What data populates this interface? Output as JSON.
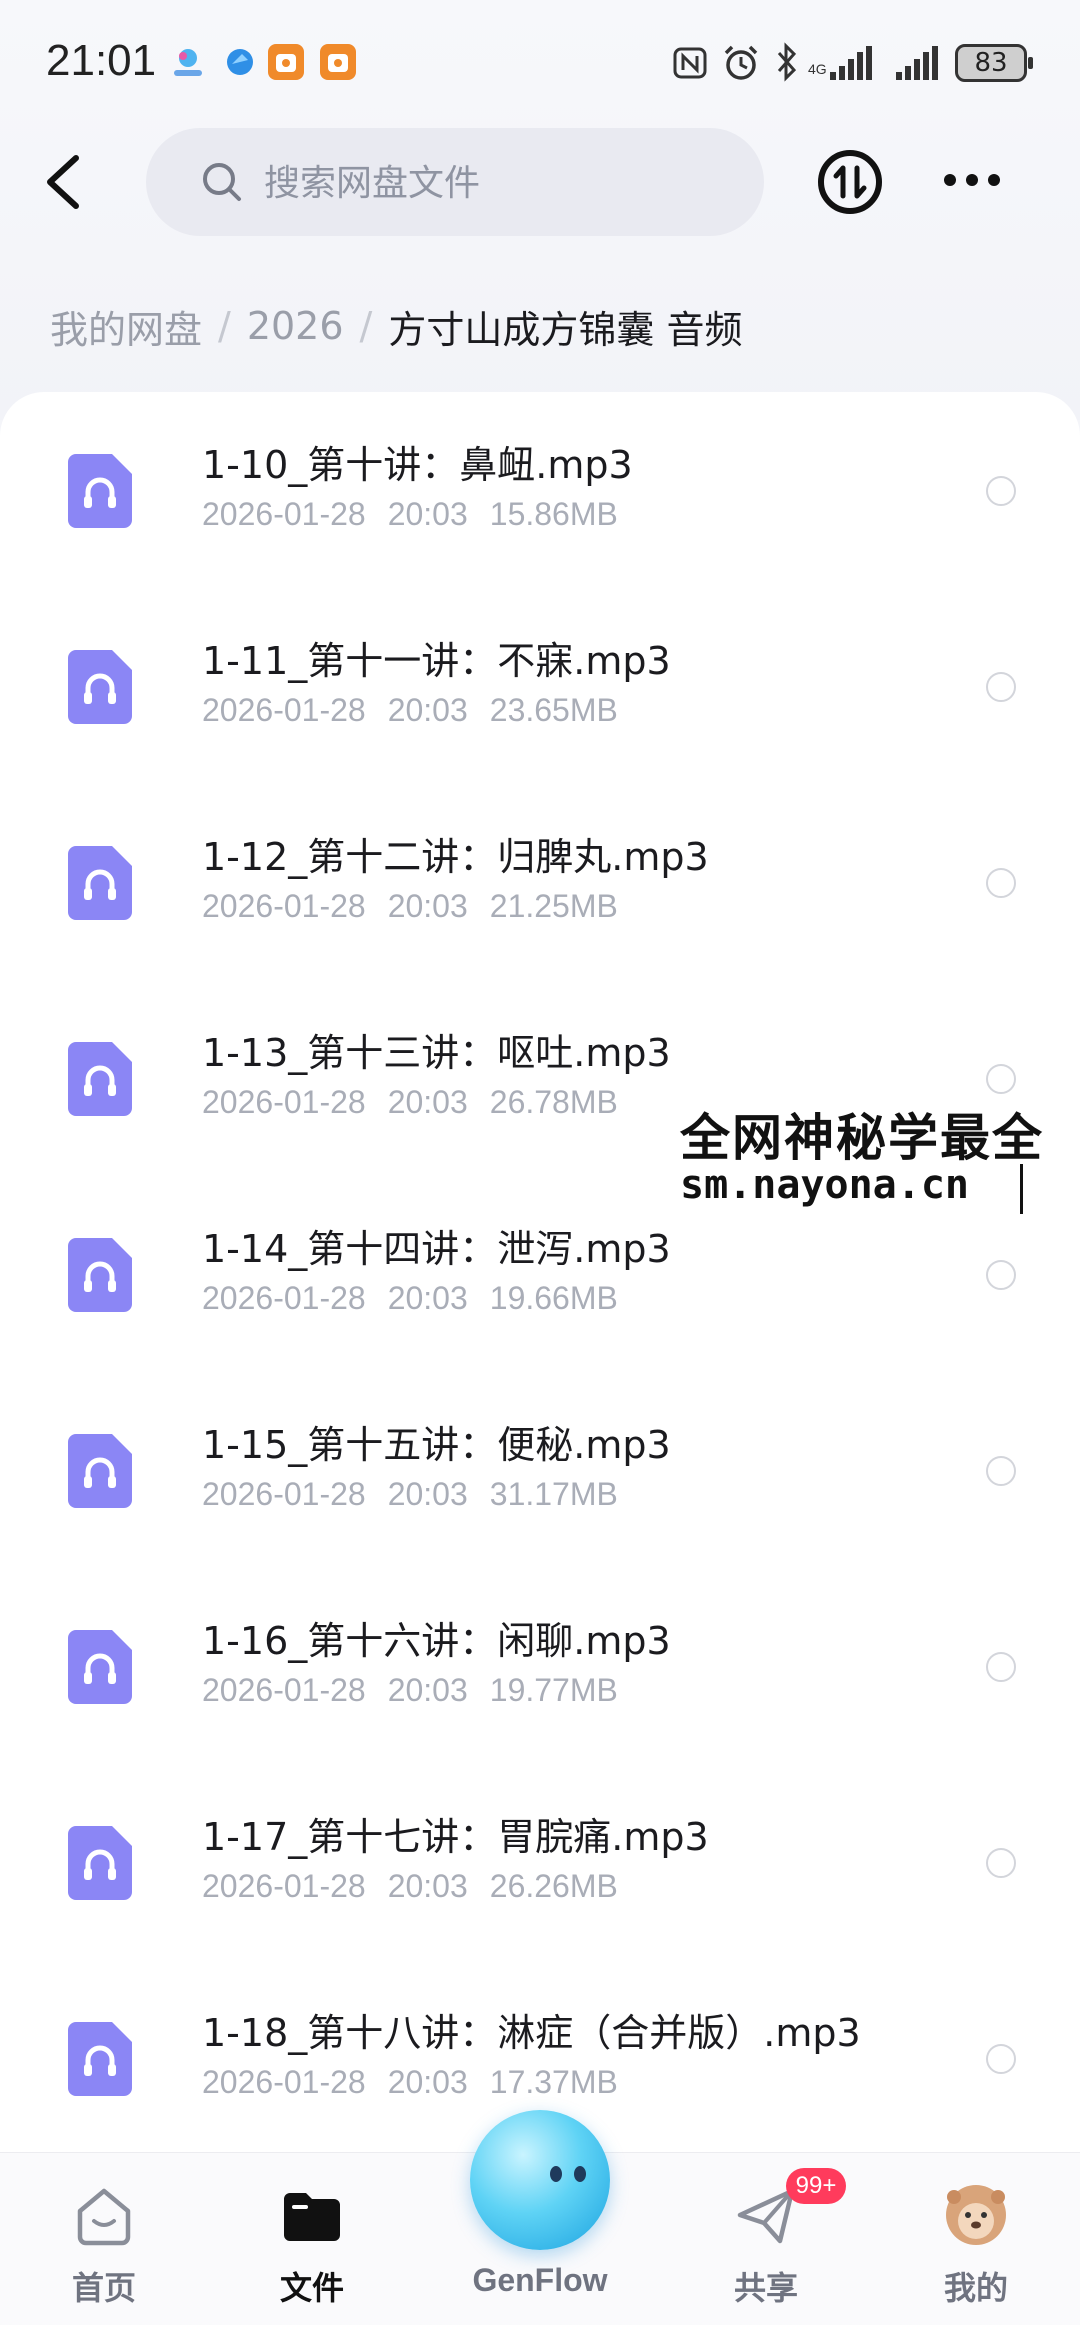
{
  "status_bar": {
    "time": "21:01",
    "battery": "83"
  },
  "header": {
    "search_placeholder": "搜索网盘文件"
  },
  "breadcrumb": [
    "我的网盘",
    "2026",
    "方寸山成方锦囊 音频"
  ],
  "files": [
    {
      "name": "1-10_第十讲：鼻衄.mp3",
      "date": "2026-01-28",
      "time": "20:03",
      "size": "15.86MB"
    },
    {
      "name": "1-11_第十一讲：不寐.mp3",
      "date": "2026-01-28",
      "time": "20:03",
      "size": "23.65MB"
    },
    {
      "name": "1-12_第十二讲：归脾丸.mp3",
      "date": "2026-01-28",
      "time": "20:03",
      "size": "21.25MB"
    },
    {
      "name": "1-13_第十三讲：呕吐.mp3",
      "date": "2026-01-28",
      "time": "20:03",
      "size": "26.78MB"
    },
    {
      "name": "1-14_第十四讲：泄泻.mp3",
      "date": "2026-01-28",
      "time": "20:03",
      "size": "19.66MB"
    },
    {
      "name": "1-15_第十五讲：便秘.mp3",
      "date": "2026-01-28",
      "time": "20:03",
      "size": "31.17MB"
    },
    {
      "name": "1-16_第十六讲：闲聊.mp3",
      "date": "2026-01-28",
      "time": "20:03",
      "size": "19.77MB"
    },
    {
      "name": "1-17_第十七讲：胃脘痛.mp3",
      "date": "2026-01-28",
      "time": "20:03",
      "size": "26.26MB"
    },
    {
      "name": "1-18_第十八讲：淋症（合并版）.mp3",
      "date": "2026-01-28",
      "time": "20:03",
      "size": "17.37MB"
    }
  ],
  "watermark": {
    "line1": "全网神秘学最全",
    "line2": "sm.nayona.cn"
  },
  "bottom_nav": {
    "home": "首页",
    "files": "文件",
    "genflow": "GenFlow",
    "share": "共享",
    "share_badge": "99+",
    "me": "我的"
  },
  "colors": {
    "file_icon": "#8b86f5",
    "badge": "#ff3b5c",
    "active_nav": "#111111"
  }
}
